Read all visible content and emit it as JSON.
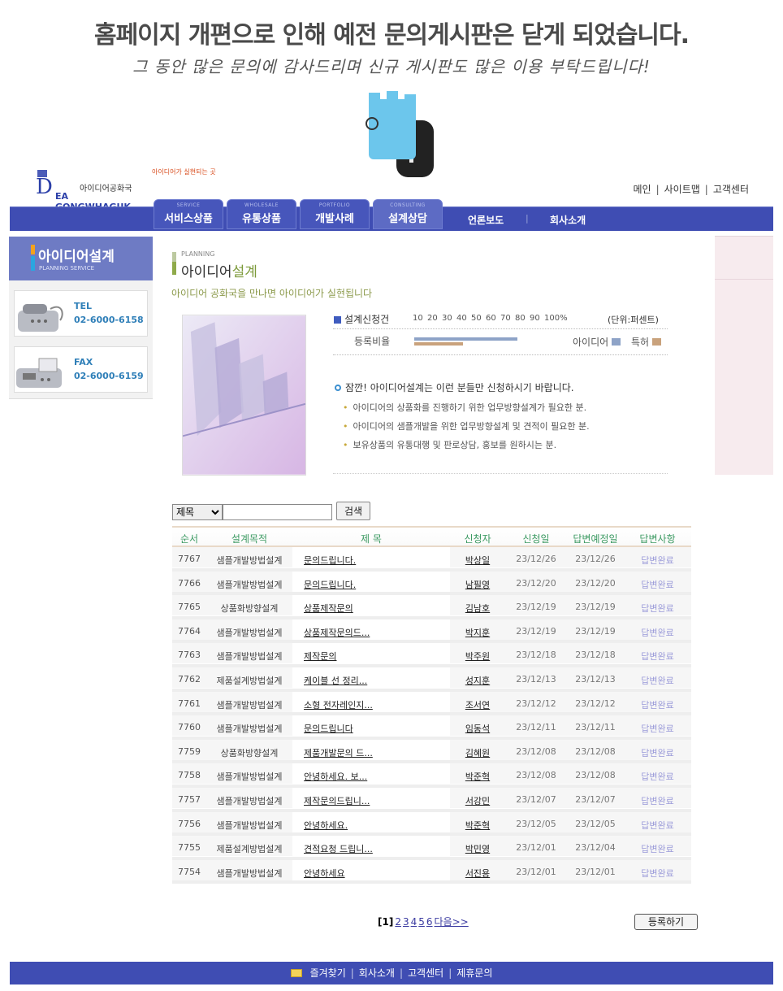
{
  "notice": {
    "main": "홈페이지 개편으로 인해 예전 문의게시판은 닫게 되었습니다.",
    "sub": "그 동안 많은 문의에 감사드리며 신규 게시판도 많은 이용 부탁드립니다!"
  },
  "logo": {
    "ko": "아이디어공화국",
    "en": "EA GONGWHAGUK",
    "letter": "D",
    "tagline": "아이디어가 실현되는 곳"
  },
  "utility_nav": [
    "메인",
    "사이트맵",
    "고객센터"
  ],
  "main_tabs": [
    {
      "en": "SERVICE",
      "label": "서비스상품"
    },
    {
      "en": "WHOLESALE",
      "label": "유통상품"
    },
    {
      "en": "PORTFOLIO",
      "label": "개발사례"
    },
    {
      "en": "CONSULTING",
      "label": "설계상담"
    }
  ],
  "sub_links": [
    "언론보도",
    "회사소개"
  ],
  "sidebar": {
    "title": "아이디어설계",
    "subtitle": "PLANNING SERVICE",
    "tel_label": "TEL",
    "tel": "02-6000-6158",
    "fax_label": "FAX",
    "fax": "02-6000-6159"
  },
  "heading": {
    "en": "PLANNING",
    "ko_prefix": "아이디어",
    "ko_highlight": "설계",
    "slogan": "아이디어 공화국을 만나면 아이디어가 실현됩니다"
  },
  "ratio_chart": {
    "title": "설계신청건",
    "ticks": [
      "10",
      "20",
      "30",
      "40",
      "50",
      "60",
      "70",
      "80",
      "90",
      "100%"
    ],
    "unit": "(단위:퍼센트)",
    "row_label": "등록비율",
    "legend_idea": "아이디어",
    "legend_patent": "특허",
    "idea_color": "#8ea3c7",
    "patent_color": "#c9a27c",
    "idea_percent": 70,
    "patent_percent": 33
  },
  "guide": {
    "head": "잠깐! 아이디어설계는 이런 분들만 신청하시기 바랍니다.",
    "items": [
      "아이디어의 상품화를 진행하기 위한 업무방향설계가 필요한 분.",
      "아이디어의 샘플개발을 위한 업무방향설계 및 견적이 필요한 분.",
      "보유상품의 유통대행 및 판로상담, 홍보를 원하시는 분."
    ]
  },
  "search": {
    "select_value": "제목",
    "button": "검색"
  },
  "table": {
    "headers": [
      "순서",
      "설계목적",
      "제 목",
      "신청자",
      "신청일",
      "답변예정일",
      "답변사항"
    ],
    "rows": [
      {
        "no": "7767",
        "purpose": "샘플개발방법설계",
        "title": "문의드립니다.",
        "name": "박상일",
        "date": "23/12/26",
        "due": "23/12/26",
        "status": "답변완료"
      },
      {
        "no": "7766",
        "purpose": "샘플개발방법설계",
        "title": "문의드립니다.",
        "name": "남필영",
        "date": "23/12/20",
        "due": "23/12/20",
        "status": "답변완료"
      },
      {
        "no": "7765",
        "purpose": "상품화방향설계",
        "title": "상품제작문의",
        "name": "김남호",
        "date": "23/12/19",
        "due": "23/12/19",
        "status": "답변완료"
      },
      {
        "no": "7764",
        "purpose": "샘플개발방법설계",
        "title": "상품제작문의드...",
        "name": "박지훈",
        "date": "23/12/19",
        "due": "23/12/19",
        "status": "답변완료"
      },
      {
        "no": "7763",
        "purpose": "샘플개발방법설계",
        "title": "제작문의",
        "name": "박주원",
        "date": "23/12/18",
        "due": "23/12/18",
        "status": "답변완료"
      },
      {
        "no": "7762",
        "purpose": "제품설계방법설계",
        "title": "케이블 선 정리...",
        "name": "성지훈",
        "date": "23/12/13",
        "due": "23/12/13",
        "status": "답변완료"
      },
      {
        "no": "7761",
        "purpose": "샘플개발방법설계",
        "title": "소형 전자레인지...",
        "name": "조서연",
        "date": "23/12/12",
        "due": "23/12/12",
        "status": "답변완료"
      },
      {
        "no": "7760",
        "purpose": "샘플개발방법설계",
        "title": "문의드립니다",
        "name": "임동석",
        "date": "23/12/11",
        "due": "23/12/11",
        "status": "답변완료"
      },
      {
        "no": "7759",
        "purpose": "상품화방향설계",
        "title": "제품개발문의 드...",
        "name": "김혜원",
        "date": "23/12/08",
        "due": "23/12/08",
        "status": "답변완료"
      },
      {
        "no": "7758",
        "purpose": "샘플개발방법설계",
        "title": "안녕하세요. 보...",
        "name": "박준혁",
        "date": "23/12/08",
        "due": "23/12/08",
        "status": "답변완료"
      },
      {
        "no": "7757",
        "purpose": "샘플개발방법설계",
        "title": "제작문의드립니...",
        "name": "서강민",
        "date": "23/12/07",
        "due": "23/12/07",
        "status": "답변완료"
      },
      {
        "no": "7756",
        "purpose": "샘플개발방법설계",
        "title": "안녕하세요.",
        "name": "박준혁",
        "date": "23/12/05",
        "due": "23/12/05",
        "status": "답변완료"
      },
      {
        "no": "7755",
        "purpose": "제품설계방법설계",
        "title": "견적요청 드립니...",
        "name": "박민영",
        "date": "23/12/01",
        "due": "23/12/04",
        "status": "답변완료"
      },
      {
        "no": "7754",
        "purpose": "샘플개발방법설계",
        "title": "안녕하세요",
        "name": "서진용",
        "date": "23/12/01",
        "due": "23/12/01",
        "status": "답변완료"
      }
    ]
  },
  "pager": {
    "current": "[1]",
    "pages": [
      "2",
      "3",
      "4",
      "5",
      "6"
    ],
    "next": "다음>>"
  },
  "register_button": "등록하기",
  "footer": [
    "즐겨찾기",
    "회사소개",
    "고객센터",
    "제휴문의"
  ]
}
